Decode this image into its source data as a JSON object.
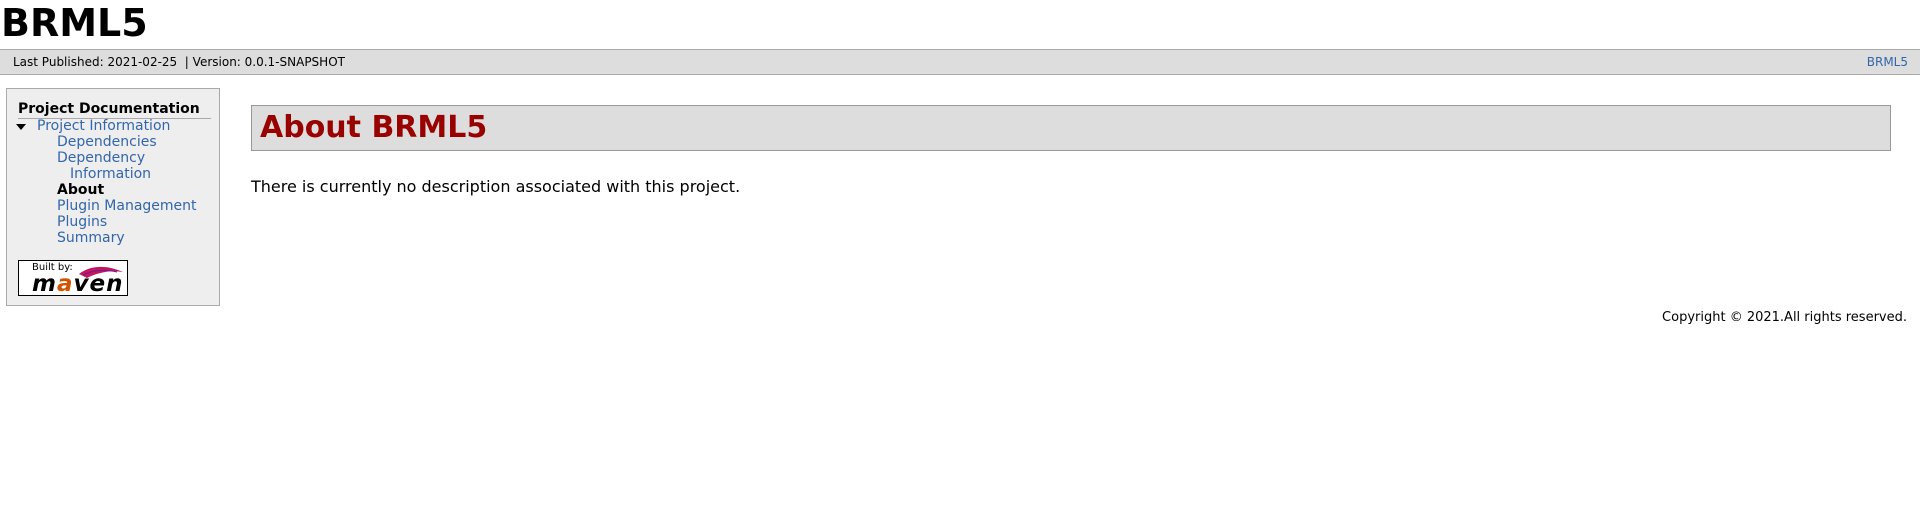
{
  "banner": {
    "title": "BRML5"
  },
  "breadcrumbs": {
    "published": "Last Published: 2021-02-25  | Version: 0.0.1-SNAPSHOT",
    "right_link": "BRML5"
  },
  "nav": {
    "heading": "Project Documentation",
    "project_information": "Project Information",
    "items": [
      {
        "label": "Dependencies"
      },
      {
        "label": "Dependency"
      },
      {
        "label": "Information"
      },
      {
        "label": "About"
      },
      {
        "label": "Plugin Management"
      },
      {
        "label": "Plugins"
      },
      {
        "label": "Summary"
      }
    ],
    "powered_by": {
      "built_by": "Built by:",
      "maven_m": "m",
      "maven_a": "a",
      "maven_rest": "ven"
    }
  },
  "content": {
    "title": "About BRML5",
    "description": "There is currently no description associated with this project."
  },
  "footer": {
    "copyright": "Copyright © 2021.All rights reserved."
  },
  "colors": {
    "link": "#3366aa",
    "title_red": "#990000",
    "bar_gray": "#dddddd",
    "nav_gray": "#eeeeee"
  }
}
